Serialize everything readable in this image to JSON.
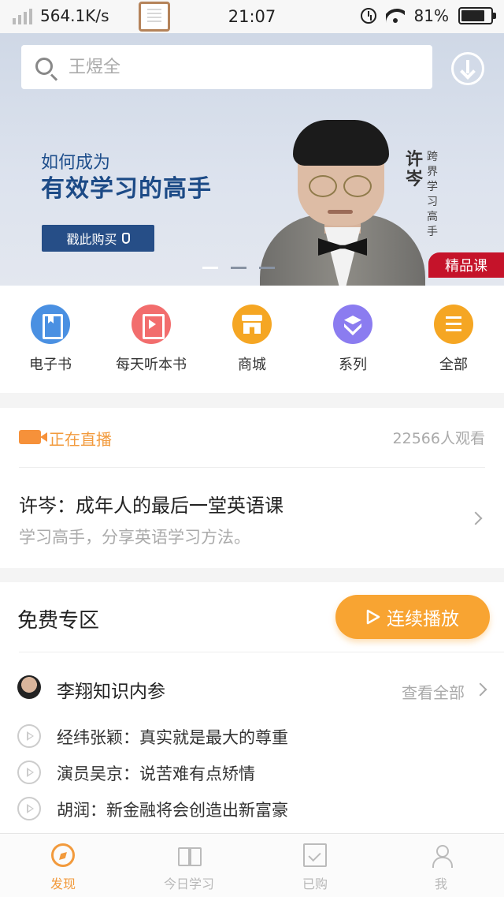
{
  "status_bar": {
    "net_speed": "564.1K/s",
    "time": "21:07",
    "battery": "81%",
    "battery_level": 0.81
  },
  "search": {
    "placeholder": "王煜全"
  },
  "banner": {
    "subtitle": "如何成为",
    "title": "有效学习的高手",
    "button_label": "戳此购买",
    "speaker_name": "许岑",
    "speaker_tag": "跨界学习高手",
    "badge": "精品课",
    "slide_index": 1,
    "slide_count": 3
  },
  "categories": [
    {
      "label": "电子书",
      "icon": "ebook-icon",
      "color": "#4a90e2"
    },
    {
      "label": "每天听本书",
      "icon": "listen-book-icon",
      "color": "#f26d6d"
    },
    {
      "label": "商城",
      "icon": "shop-icon",
      "color": "#f5a623"
    },
    {
      "label": "系列",
      "icon": "series-icon",
      "color": "#8b7cf0"
    },
    {
      "label": "全部",
      "icon": "all-menu-icon",
      "color": "#f5a623"
    }
  ],
  "live": {
    "label": "正在直播",
    "viewers": "22566人观看",
    "title": "许岑：成年人的最后一堂英语课",
    "description": "学习高手，分享英语学习方法。"
  },
  "free_zone": {
    "title": "免费专区",
    "play_all_label": "连续播放",
    "column": {
      "title": "李翔知识内参",
      "see_all": "查看全部"
    },
    "episodes": [
      "经纬张颖：真实就是最大的尊重",
      "演员吴京：说苦难有点矫情",
      "胡润：新金融将会创造出新富豪"
    ]
  },
  "tabbar": [
    {
      "label": "发现",
      "icon": "compass-icon",
      "active": true
    },
    {
      "label": "今日学习",
      "icon": "open-book-icon",
      "active": false
    },
    {
      "label": "已购",
      "icon": "purchased-icon",
      "active": false
    },
    {
      "label": "我",
      "icon": "profile-icon",
      "active": false
    }
  ],
  "colors": {
    "accent": "#f29a3c",
    "play_button": "#f8a432",
    "banner_title": "#1c4a86",
    "badge": "#c5132a"
  }
}
